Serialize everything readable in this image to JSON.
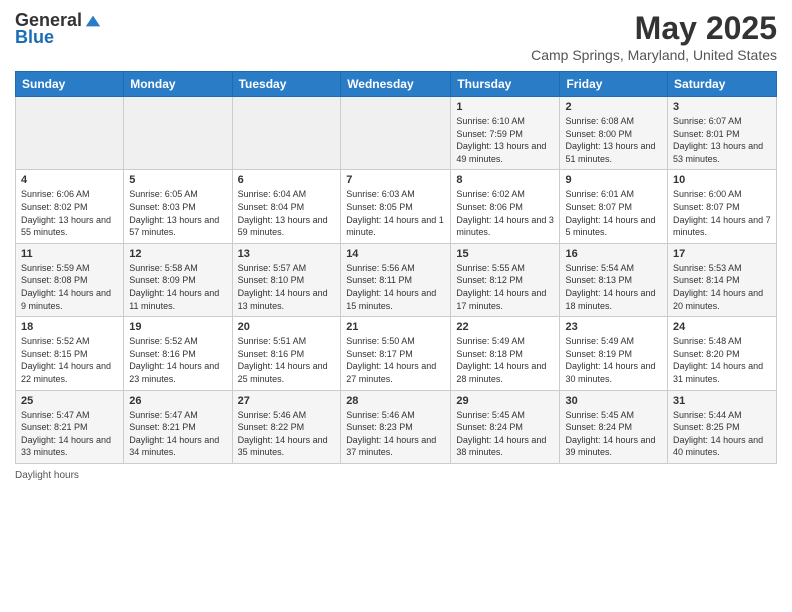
{
  "header": {
    "logo_general": "General",
    "logo_blue": "Blue",
    "month": "May 2025",
    "location": "Camp Springs, Maryland, United States"
  },
  "days_of_week": [
    "Sunday",
    "Monday",
    "Tuesday",
    "Wednesday",
    "Thursday",
    "Friday",
    "Saturday"
  ],
  "weeks": [
    [
      {
        "day": "",
        "info": ""
      },
      {
        "day": "",
        "info": ""
      },
      {
        "day": "",
        "info": ""
      },
      {
        "day": "",
        "info": ""
      },
      {
        "day": "1",
        "info": "Sunrise: 6:10 AM\nSunset: 7:59 PM\nDaylight: 13 hours and 49 minutes."
      },
      {
        "day": "2",
        "info": "Sunrise: 6:08 AM\nSunset: 8:00 PM\nDaylight: 13 hours and 51 minutes."
      },
      {
        "day": "3",
        "info": "Sunrise: 6:07 AM\nSunset: 8:01 PM\nDaylight: 13 hours and 53 minutes."
      }
    ],
    [
      {
        "day": "4",
        "info": "Sunrise: 6:06 AM\nSunset: 8:02 PM\nDaylight: 13 hours and 55 minutes."
      },
      {
        "day": "5",
        "info": "Sunrise: 6:05 AM\nSunset: 8:03 PM\nDaylight: 13 hours and 57 minutes."
      },
      {
        "day": "6",
        "info": "Sunrise: 6:04 AM\nSunset: 8:04 PM\nDaylight: 13 hours and 59 minutes."
      },
      {
        "day": "7",
        "info": "Sunrise: 6:03 AM\nSunset: 8:05 PM\nDaylight: 14 hours and 1 minute."
      },
      {
        "day": "8",
        "info": "Sunrise: 6:02 AM\nSunset: 8:06 PM\nDaylight: 14 hours and 3 minutes."
      },
      {
        "day": "9",
        "info": "Sunrise: 6:01 AM\nSunset: 8:07 PM\nDaylight: 14 hours and 5 minutes."
      },
      {
        "day": "10",
        "info": "Sunrise: 6:00 AM\nSunset: 8:07 PM\nDaylight: 14 hours and 7 minutes."
      }
    ],
    [
      {
        "day": "11",
        "info": "Sunrise: 5:59 AM\nSunset: 8:08 PM\nDaylight: 14 hours and 9 minutes."
      },
      {
        "day": "12",
        "info": "Sunrise: 5:58 AM\nSunset: 8:09 PM\nDaylight: 14 hours and 11 minutes."
      },
      {
        "day": "13",
        "info": "Sunrise: 5:57 AM\nSunset: 8:10 PM\nDaylight: 14 hours and 13 minutes."
      },
      {
        "day": "14",
        "info": "Sunrise: 5:56 AM\nSunset: 8:11 PM\nDaylight: 14 hours and 15 minutes."
      },
      {
        "day": "15",
        "info": "Sunrise: 5:55 AM\nSunset: 8:12 PM\nDaylight: 14 hours and 17 minutes."
      },
      {
        "day": "16",
        "info": "Sunrise: 5:54 AM\nSunset: 8:13 PM\nDaylight: 14 hours and 18 minutes."
      },
      {
        "day": "17",
        "info": "Sunrise: 5:53 AM\nSunset: 8:14 PM\nDaylight: 14 hours and 20 minutes."
      }
    ],
    [
      {
        "day": "18",
        "info": "Sunrise: 5:52 AM\nSunset: 8:15 PM\nDaylight: 14 hours and 22 minutes."
      },
      {
        "day": "19",
        "info": "Sunrise: 5:52 AM\nSunset: 8:16 PM\nDaylight: 14 hours and 23 minutes."
      },
      {
        "day": "20",
        "info": "Sunrise: 5:51 AM\nSunset: 8:16 PM\nDaylight: 14 hours and 25 minutes."
      },
      {
        "day": "21",
        "info": "Sunrise: 5:50 AM\nSunset: 8:17 PM\nDaylight: 14 hours and 27 minutes."
      },
      {
        "day": "22",
        "info": "Sunrise: 5:49 AM\nSunset: 8:18 PM\nDaylight: 14 hours and 28 minutes."
      },
      {
        "day": "23",
        "info": "Sunrise: 5:49 AM\nSunset: 8:19 PM\nDaylight: 14 hours and 30 minutes."
      },
      {
        "day": "24",
        "info": "Sunrise: 5:48 AM\nSunset: 8:20 PM\nDaylight: 14 hours and 31 minutes."
      }
    ],
    [
      {
        "day": "25",
        "info": "Sunrise: 5:47 AM\nSunset: 8:21 PM\nDaylight: 14 hours and 33 minutes."
      },
      {
        "day": "26",
        "info": "Sunrise: 5:47 AM\nSunset: 8:21 PM\nDaylight: 14 hours and 34 minutes."
      },
      {
        "day": "27",
        "info": "Sunrise: 5:46 AM\nSunset: 8:22 PM\nDaylight: 14 hours and 35 minutes."
      },
      {
        "day": "28",
        "info": "Sunrise: 5:46 AM\nSunset: 8:23 PM\nDaylight: 14 hours and 37 minutes."
      },
      {
        "day": "29",
        "info": "Sunrise: 5:45 AM\nSunset: 8:24 PM\nDaylight: 14 hours and 38 minutes."
      },
      {
        "day": "30",
        "info": "Sunrise: 5:45 AM\nSunset: 8:24 PM\nDaylight: 14 hours and 39 minutes."
      },
      {
        "day": "31",
        "info": "Sunrise: 5:44 AM\nSunset: 8:25 PM\nDaylight: 14 hours and 40 minutes."
      }
    ]
  ],
  "footer": {
    "note": "Daylight hours"
  }
}
